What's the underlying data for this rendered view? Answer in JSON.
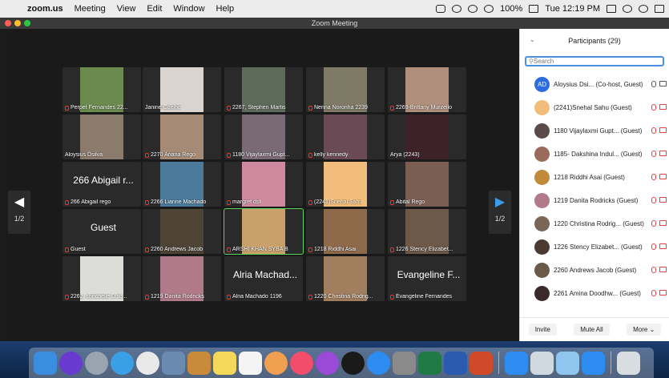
{
  "menubar": {
    "app": "zoom.us",
    "items": [
      "Meeting",
      "View",
      "Edit",
      "Window",
      "Help"
    ],
    "battery": "100%",
    "clock": "Tue 12:19 PM"
  },
  "window": {
    "title": "Zoom Meeting"
  },
  "gallery": {
    "page_left": "1/2",
    "page_right": "1/2",
    "tiles": [
      {
        "name": "Perpet Fernandes 22...",
        "muted": true,
        "bg": "#6b8a4e"
      },
      {
        "name": "Janine Coelho",
        "muted": false,
        "bg": "#d9d4cf"
      },
      {
        "name": "2267, Stephen Martis",
        "muted": true,
        "bg": "#5e6a5a"
      },
      {
        "name": "Nerina Noronha 2239",
        "muted": true,
        "bg": "#7e7a66"
      },
      {
        "name": "2269-Brittany Murzello",
        "muted": true,
        "bg": "#b08e7c"
      },
      {
        "name": "Aloysius Dsilva",
        "muted": false,
        "bg": "#8b7b6c"
      },
      {
        "name": "2270 Ariana Rego",
        "muted": true,
        "bg": "#a58a76"
      },
      {
        "name": "1180 Vijaylaxmi Gupt...",
        "muted": true,
        "bg": "#7a6a78"
      },
      {
        "name": "kelly kennedy",
        "muted": true,
        "bg": "#6a4b55"
      },
      {
        "name": "Arya (2243)",
        "muted": false,
        "bg": "#3e2229"
      },
      {
        "name": "266 Abigail rego",
        "muted": true,
        "big": "266 Abigail r...",
        "bg": ""
      },
      {
        "name": "2266 Lianne Machado",
        "muted": true,
        "bg": "#4b7a9a"
      },
      {
        "name": "margret dst",
        "muted": true,
        "bg": "#d08aa0"
      },
      {
        "name": "(2241)Snehal Sahu",
        "muted": true,
        "bg": "#f2bd7a"
      },
      {
        "name": "Abital Rego",
        "muted": true,
        "bg": "#7a5e54"
      },
      {
        "name": "Guest",
        "muted": true,
        "big": "Guest",
        "bg": ""
      },
      {
        "name": "2260 Andrews Jacob",
        "muted": true,
        "bg": "#4e4436"
      },
      {
        "name": "ARSHI KHAN SYBA B",
        "muted": true,
        "bg": "#c9a06a",
        "active": true
      },
      {
        "name": "1218 Riddhi Asai",
        "muted": true,
        "bg": "#8e6a4a"
      },
      {
        "name": "1226 Stency Elizabet...",
        "muted": true,
        "bg": "#6e5848"
      },
      {
        "name": "2262, chrichelle D'so...",
        "muted": true,
        "bg": "#dcdcd8"
      },
      {
        "name": "1219 Danita Rodricks",
        "muted": true,
        "bg": "#b07a8a"
      },
      {
        "name": "Alria Machado 1196",
        "muted": true,
        "big": "Alria Machad...",
        "bg": ""
      },
      {
        "name": "1220 Christina Rodrig...",
        "muted": true,
        "bg": "#a07e5e"
      },
      {
        "name": "Evangeline Fernandes",
        "muted": true,
        "big": "Evangeline F...",
        "bg": ""
      }
    ]
  },
  "participants": {
    "title": "Participants (29)",
    "search_placeholder": "Search",
    "list": [
      {
        "name": "Aloysius Dsi... (Co-host, Guest)",
        "avatar_text": "AD",
        "avatar_color": "#2d6cdf",
        "mic_on": true,
        "cam_on": true
      },
      {
        "name": "(2241)Snehal Sahu (Guest)",
        "avatar_text": "",
        "avatar_color": "#f2bd7a",
        "mic_on": false,
        "cam_on": false
      },
      {
        "name": "1180 Vijaylaxmi Gupt...  (Guest)",
        "avatar_text": "",
        "avatar_color": "#5a4a4a",
        "mic_on": false,
        "cam_on": false
      },
      {
        "name": "1185- Dakshina Indul...  (Guest)",
        "avatar_text": "",
        "avatar_color": "#9a6a5a",
        "mic_on": false,
        "cam_on": false
      },
      {
        "name": "1218 Riddhi Asai (Guest)",
        "avatar_text": "",
        "avatar_color": "#c08a3a",
        "mic_on": false,
        "cam_on": false
      },
      {
        "name": "1219 Danita Rodricks (Guest)",
        "avatar_text": "",
        "avatar_color": "#b07a8a",
        "mic_on": false,
        "cam_on": false
      },
      {
        "name": "1220 Christina Rodrig...  (Guest)",
        "avatar_text": "",
        "avatar_color": "#7a6656",
        "mic_on": false,
        "cam_on": false
      },
      {
        "name": "1226 Stency Elizabet...  (Guest)",
        "avatar_text": "",
        "avatar_color": "#4a3a32",
        "mic_on": false,
        "cam_on": false
      },
      {
        "name": "2260 Andrews Jacob (Guest)",
        "avatar_text": "",
        "avatar_color": "#6a5a4a",
        "mic_on": false,
        "cam_on": false
      },
      {
        "name": "2261 Amina Doodhw...  (Guest)",
        "avatar_text": "",
        "avatar_color": "#3a2a2a",
        "mic_on": false,
        "cam_on": false
      }
    ],
    "footer": {
      "invite": "Invite",
      "mute_all": "Mute All",
      "more": "More"
    }
  },
  "dock": {
    "apps": [
      {
        "icon": "finder-icon",
        "color": "#3b8de0"
      },
      {
        "icon": "siri-icon",
        "color": "#6a3ad0"
      },
      {
        "icon": "launchpad-icon",
        "color": "#9aa3b0"
      },
      {
        "icon": "safari-icon",
        "color": "#3aa0e6"
      },
      {
        "icon": "chrome-icon",
        "color": "#e9e9e9"
      },
      {
        "icon": "preview-icon",
        "color": "#6a8ab0"
      },
      {
        "icon": "books-icon",
        "color": "#c98a3a"
      },
      {
        "icon": "notes-icon",
        "color": "#f5d85a"
      },
      {
        "icon": "calendar-icon",
        "color": "#f4f4f4"
      },
      {
        "icon": "photos-icon",
        "color": "#f0a050"
      },
      {
        "icon": "music-icon",
        "color": "#f04e6a"
      },
      {
        "icon": "podcasts-icon",
        "color": "#9a4ad6"
      },
      {
        "icon": "tv-icon",
        "color": "#1a1a1a"
      },
      {
        "icon": "app-store-icon",
        "color": "#2d8cf0"
      },
      {
        "icon": "system-preferences-icon",
        "color": "#8a8a8a"
      },
      {
        "icon": "excel-icon",
        "color": "#1f7a44"
      },
      {
        "icon": "word-icon",
        "color": "#2a5bb0"
      },
      {
        "icon": "powerpoint-icon",
        "color": "#d04a2a"
      },
      {
        "icon": "zoom-icon",
        "color": "#2d8cf0"
      },
      {
        "icon": "image-capture-icon",
        "color": "#d0d8e0"
      },
      {
        "icon": "finder-face-icon",
        "color": "#8ec6f0"
      },
      {
        "icon": "facetime-icon",
        "color": "#2d8cf0"
      }
    ],
    "trash": {
      "icon": "trash-icon",
      "color": "#d8dde2"
    }
  }
}
